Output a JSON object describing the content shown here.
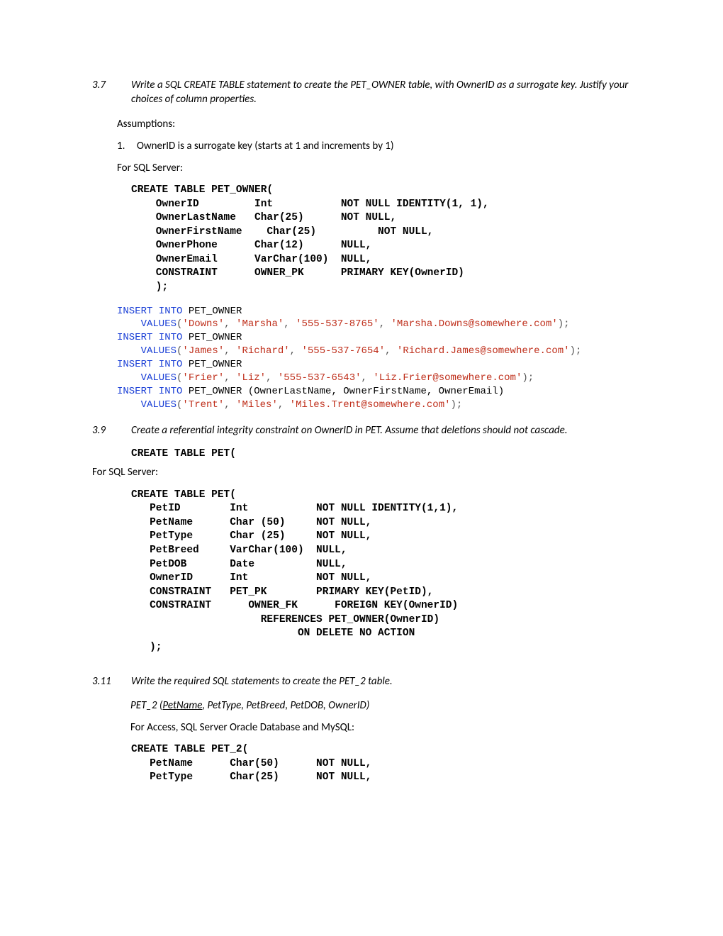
{
  "q37": {
    "num": "3.7",
    "text": "Write a SQL CREATE TABLE statement to create the PET_OWNER table, with OwnerID as a surrogate key.  Justify your choices of column properties.",
    "assumptions": "Assumptions:",
    "assump1_num": "1.",
    "assump1": "OwnerID is a surrogate key (starts at 1 and increments by 1)",
    "forsql": "For SQL Server:",
    "code": "CREATE TABLE PET_OWNER(\n    OwnerID         Int           NOT NULL IDENTITY(1, 1),\n    OwnerLastName   Char(25)      NOT NULL,\n    OwnerFirstName    Char(25)          NOT NULL,\n    OwnerPhone      Char(12)      NULL,\n    OwnerEmail      VarChar(100)  NULL,\n    CONSTRAINT      OWNER_PK      PRIMARY KEY(OwnerID)\n    );",
    "ins1_a": "INSERT INTO",
    "ins_tbl": " PET_OWNER",
    "ins1_b": "    VALUES",
    "ins1_c": "(",
    "v1a": "'Downs'",
    "v1b": "'Marsha'",
    "v1c": "'555-537-8765'",
    "v1d": "'Marsha.Downs@somewhere.com'",
    "v2a": "'James'",
    "v2b": "'Richard'",
    "v2c": "'555-537-7654'",
    "v2d": "'Richard.James@somewhere.com'",
    "v3a": "'Frier'",
    "v3b": "'Liz'",
    "v3c": "'555-537-6543'",
    "v3d": "'Liz.Frier@somewhere.com'",
    "ins4_cols": " PET_OWNER (OwnerLastName, OwnerFirstName, OwnerEmail)",
    "v4a": "'Trent'",
    "v4b": "'Miles'",
    "v4c": "'Miles.Trent@somewhere.com'",
    "comma": ", ",
    "close": ");"
  },
  "q39": {
    "num": "3.9",
    "text": "Create a referential integrity constraint on OwnerID in PET. Assume that deletions should not cascade.",
    "code0": "CREATE TABLE PET(",
    "forsql": "For SQL Server:",
    "code": "CREATE TABLE PET(\n   PetID        Int           NOT NULL IDENTITY(1,1),\n   PetName      Char (50)     NOT NULL,\n   PetType      Char (25)     NOT NULL,\n   PetBreed     VarChar(100)  NULL,\n   PetDOB       Date          NULL,\n   OwnerID      Int           NOT NULL,\n   CONSTRAINT   PET_PK        PRIMARY KEY(PetID),\n   CONSTRAINT      OWNER_FK      FOREIGN KEY(OwnerID)\n                     REFERENCES PET_OWNER(OwnerID)\n                           ON DELETE NO ACTION\n   );"
  },
  "q311": {
    "num": "3.11",
    "text": "Write the required SQL statements to create the PET_2 table.",
    "schema_pre": "PET_2 (",
    "schema_u": "PetName",
    "schema_post": ", PetType, PetBreed, PetDOB, OwnerID)",
    "fordb": "For Access, SQL Server Oracle Database and MySQL:",
    "code": "CREATE TABLE PET_2(\n   PetName      Char(50)      NOT NULL,\n   PetType      Char(25)      NOT NULL,"
  }
}
